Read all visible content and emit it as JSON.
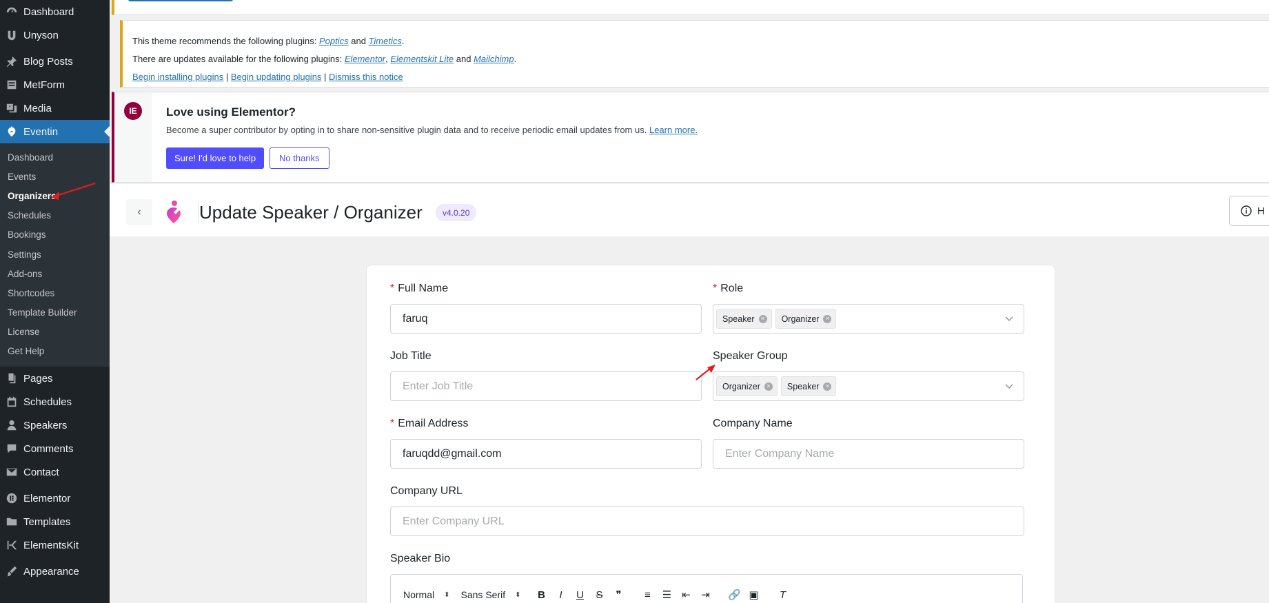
{
  "sidebar": {
    "top_items": [
      {
        "label": "Dashboard",
        "icon": "gauge-icon"
      },
      {
        "label": "Unyson",
        "icon": "unyson-icon"
      },
      {
        "label": "Blog Posts",
        "icon": "pin-icon"
      },
      {
        "label": "MetForm",
        "icon": "form-icon"
      },
      {
        "label": "Media",
        "icon": "media-icon"
      },
      {
        "label": "Eventin",
        "icon": "eventin-icon"
      }
    ],
    "eventin_submenu": [
      "Dashboard",
      "Events",
      "Organizers",
      "Schedules",
      "Bookings",
      "Settings",
      "Add-ons",
      "Shortcodes",
      "Template Builder",
      "License",
      "Get Help"
    ],
    "bottom_items": [
      {
        "label": "Pages",
        "icon": "pages-icon"
      },
      {
        "label": "Schedules",
        "icon": "calendar-icon"
      },
      {
        "label": "Speakers",
        "icon": "person-icon"
      },
      {
        "label": "Comments",
        "icon": "comment-icon"
      },
      {
        "label": "Contact",
        "icon": "mail-icon"
      },
      {
        "label": "Elementor",
        "icon": "elementor-icon"
      },
      {
        "label": "Templates",
        "icon": "folder-icon"
      },
      {
        "label": "ElementsKit",
        "icon": "elementskit-icon"
      },
      {
        "label": "Appearance",
        "icon": "brush-icon"
      }
    ]
  },
  "plugin_notice": {
    "line1_prefix": "This theme recommends the following plugins:",
    "line1_plugin_a": "Poptics",
    "line1_and": "and",
    "line1_plugin_b": "Timetics",
    "line2_prefix": "There are updates available for the following plugins:",
    "line2_plugin_a": "Elementor",
    "line2_plugin_b": "Elementskit Lite",
    "line2_and": "and",
    "line2_plugin_c": "Mailchimp",
    "link_install": "Begin installing plugins",
    "link_update": "Begin updating plugins",
    "link_dismiss": "Dismiss this notice"
  },
  "elementor_notice": {
    "title": "Love using Elementor?",
    "text": "Become a super contributor by opting in to share non-sensitive plugin data and to receive periodic email updates from us.",
    "learn_more": "Learn more.",
    "accept_label": "Sure! I'd love to help",
    "decline_label": "No thanks"
  },
  "header": {
    "title": "Update Speaker / Organizer",
    "version": "v4.0.20",
    "help_label": "H"
  },
  "form": {
    "full_name": {
      "label": "Full Name",
      "value": "faruq"
    },
    "role": {
      "label": "Role",
      "tags": [
        "Speaker",
        "Organizer"
      ]
    },
    "job_title": {
      "label": "Job Title",
      "placeholder": "Enter Job Title"
    },
    "speaker_group": {
      "label": "Speaker Group",
      "tags": [
        "Organizer",
        "Speaker"
      ]
    },
    "email": {
      "label": "Email Address",
      "value": "faruqdd@gmail.com"
    },
    "company_name": {
      "label": "Company Name",
      "placeholder": "Enter Company Name"
    },
    "company_url": {
      "label": "Company URL",
      "placeholder": "Enter Company URL"
    },
    "bio": {
      "label": "Speaker Bio"
    },
    "required_mark": "*"
  },
  "editor_toolbar": {
    "heading_select": "Normal",
    "font_select": "Sans Serif",
    "buttons": [
      {
        "label": "B",
        "icon": "bold-icon"
      },
      {
        "label": "I",
        "icon": "italic-icon"
      },
      {
        "label": "U",
        "icon": "underline-icon"
      },
      {
        "label": "S",
        "icon": "strike-icon"
      },
      {
        "label": "❞",
        "icon": "quote-icon"
      },
      {
        "label": "≡",
        "icon": "ordered-list-icon"
      },
      {
        "label": "☰",
        "icon": "bullet-list-icon"
      },
      {
        "label": "⇤",
        "icon": "outdent-icon"
      },
      {
        "label": "⇥",
        "icon": "indent-icon"
      },
      {
        "label": "🔗",
        "icon": "link-icon"
      },
      {
        "label": "▣",
        "icon": "image-icon"
      },
      {
        "label": "T",
        "icon": "clear-format-icon"
      }
    ]
  },
  "colors": {
    "sidebar_bg": "#1d2327",
    "accent": "#2271b1",
    "elementor": "#93003c",
    "primary_button": "#524cff",
    "annotation_arrow": "#e01e1e"
  }
}
